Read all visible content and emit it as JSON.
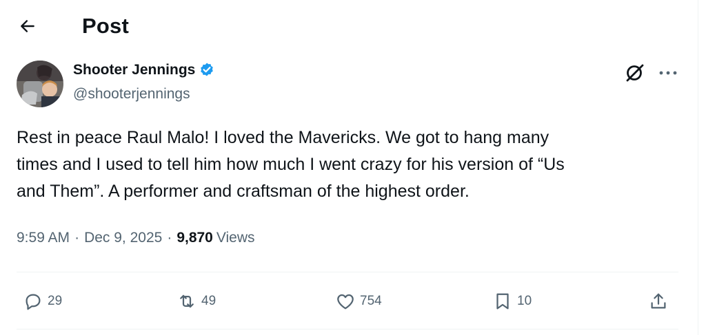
{
  "header": {
    "title": "Post"
  },
  "post": {
    "display_name": "Shooter Jennings",
    "handle": "@shooterjennings",
    "text": "Rest in peace Raul Malo! I loved the Mavericks. We got to hang many\ntimes and I used to tell him how much I went crazy for his version of “Us\nand Them”. A performer and craftsman of the highest order.",
    "time": "9:59 AM",
    "separator": "·",
    "date": "Dec 9, 2025",
    "views_count": "9,870",
    "views_label": "Views"
  },
  "actions": {
    "replies": "29",
    "reposts": "49",
    "likes": "754",
    "bookmarks": "10"
  },
  "colors": {
    "text_primary": "#0f1419",
    "text_secondary": "#536471",
    "verified_blue": "#1d9bf0",
    "divider": "#eff3f4"
  },
  "icons": [
    "back-arrow-icon",
    "verified-badge-icon",
    "grok-icon",
    "more-icon",
    "reply-icon",
    "repost-icon",
    "like-icon",
    "bookmark-icon",
    "share-icon"
  ]
}
